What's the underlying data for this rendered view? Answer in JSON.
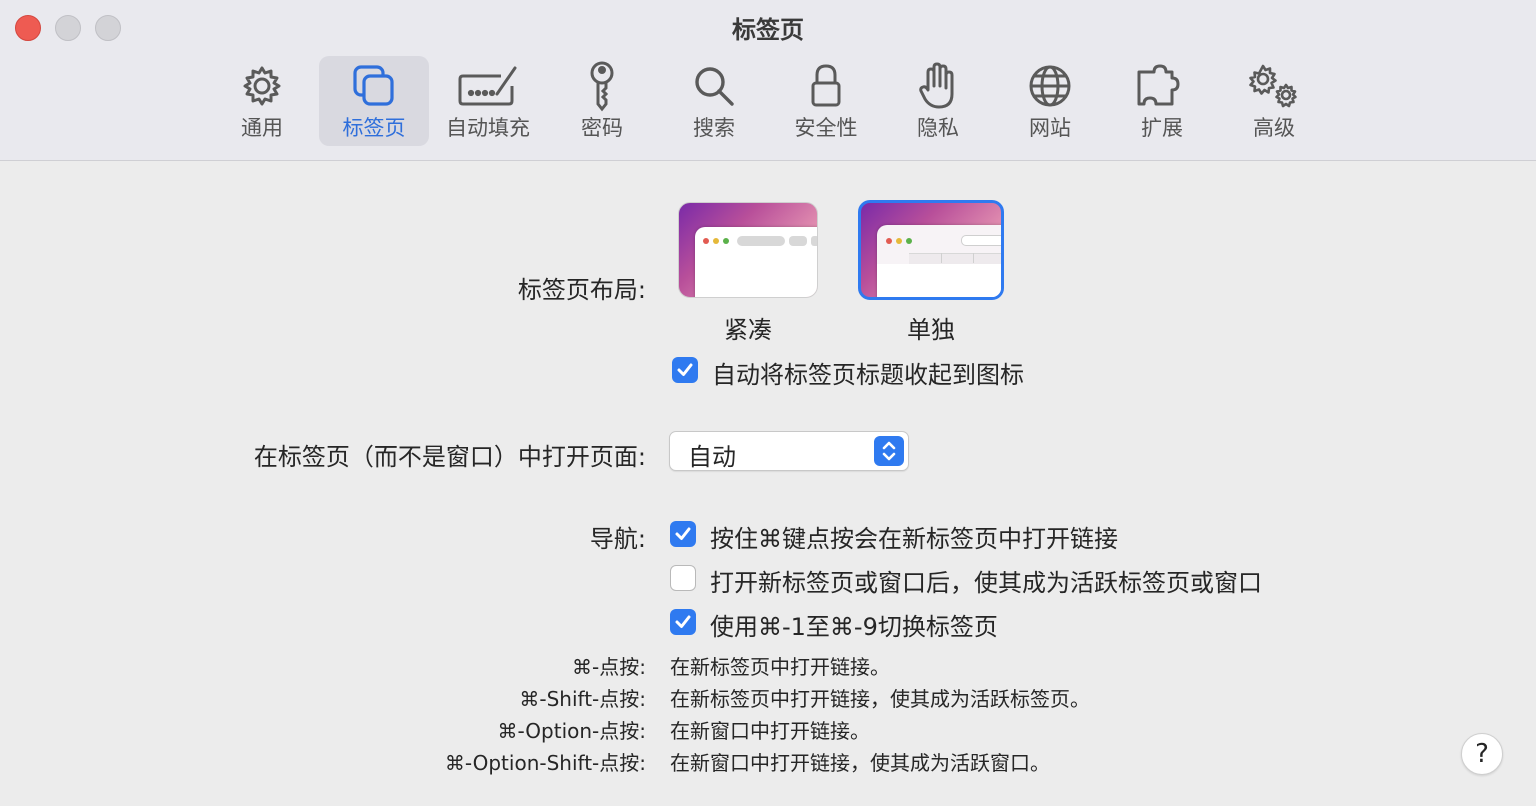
{
  "window": {
    "title": "标签页"
  },
  "toolbar": {
    "tabs": [
      {
        "label": "通用",
        "icon": "gear-icon"
      },
      {
        "label": "标签页",
        "icon": "tabs-icon",
        "selected": true
      },
      {
        "label": "自动填充",
        "icon": "autofill-icon"
      },
      {
        "label": "密码",
        "icon": "key-icon"
      },
      {
        "label": "搜索",
        "icon": "search-icon"
      },
      {
        "label": "安全性",
        "icon": "lock-icon"
      },
      {
        "label": "隐私",
        "icon": "hand-icon"
      },
      {
        "label": "网站",
        "icon": "globe-icon"
      },
      {
        "label": "扩展",
        "icon": "puzzle-icon"
      },
      {
        "label": "高级",
        "icon": "gears-icon"
      }
    ]
  },
  "tab_layout": {
    "label": "标签页布局:",
    "options": [
      {
        "caption": "紧凑",
        "selected": false
      },
      {
        "caption": "单独",
        "selected": true
      }
    ],
    "collapse_checkbox": {
      "label": "自动将标签页标题收起到图标",
      "checked": true
    }
  },
  "open_pages": {
    "label": "在标签页（而不是窗口）中打开页面:",
    "value": "自动"
  },
  "navigation": {
    "label": "导航:",
    "options": [
      {
        "label": "按住⌘键点按会在新标签页中打开链接",
        "checked": true
      },
      {
        "label": "打开新标签页或窗口后，使其成为活跃标签页或窗口",
        "checked": false
      },
      {
        "label": "使用⌘-1至⌘-9切换标签页",
        "checked": true
      }
    ]
  },
  "shortcuts": [
    {
      "key": "⌘-点按:",
      "desc": "在新标签页中打开链接。"
    },
    {
      "key": "⌘-Shift-点按:",
      "desc": "在新标签页中打开链接，使其成为活跃标签页。"
    },
    {
      "key": "⌘-Option-点按:",
      "desc": "在新窗口中打开链接。"
    },
    {
      "key": "⌘-Option-Shift-点按:",
      "desc": "在新窗口中打开链接，使其成为活跃窗口。"
    }
  ],
  "help": {
    "label": "?"
  },
  "colors": {
    "accent": "#2f7af0",
    "selected_tab_text": "#2f6fdb",
    "close": "#ee5b52"
  }
}
